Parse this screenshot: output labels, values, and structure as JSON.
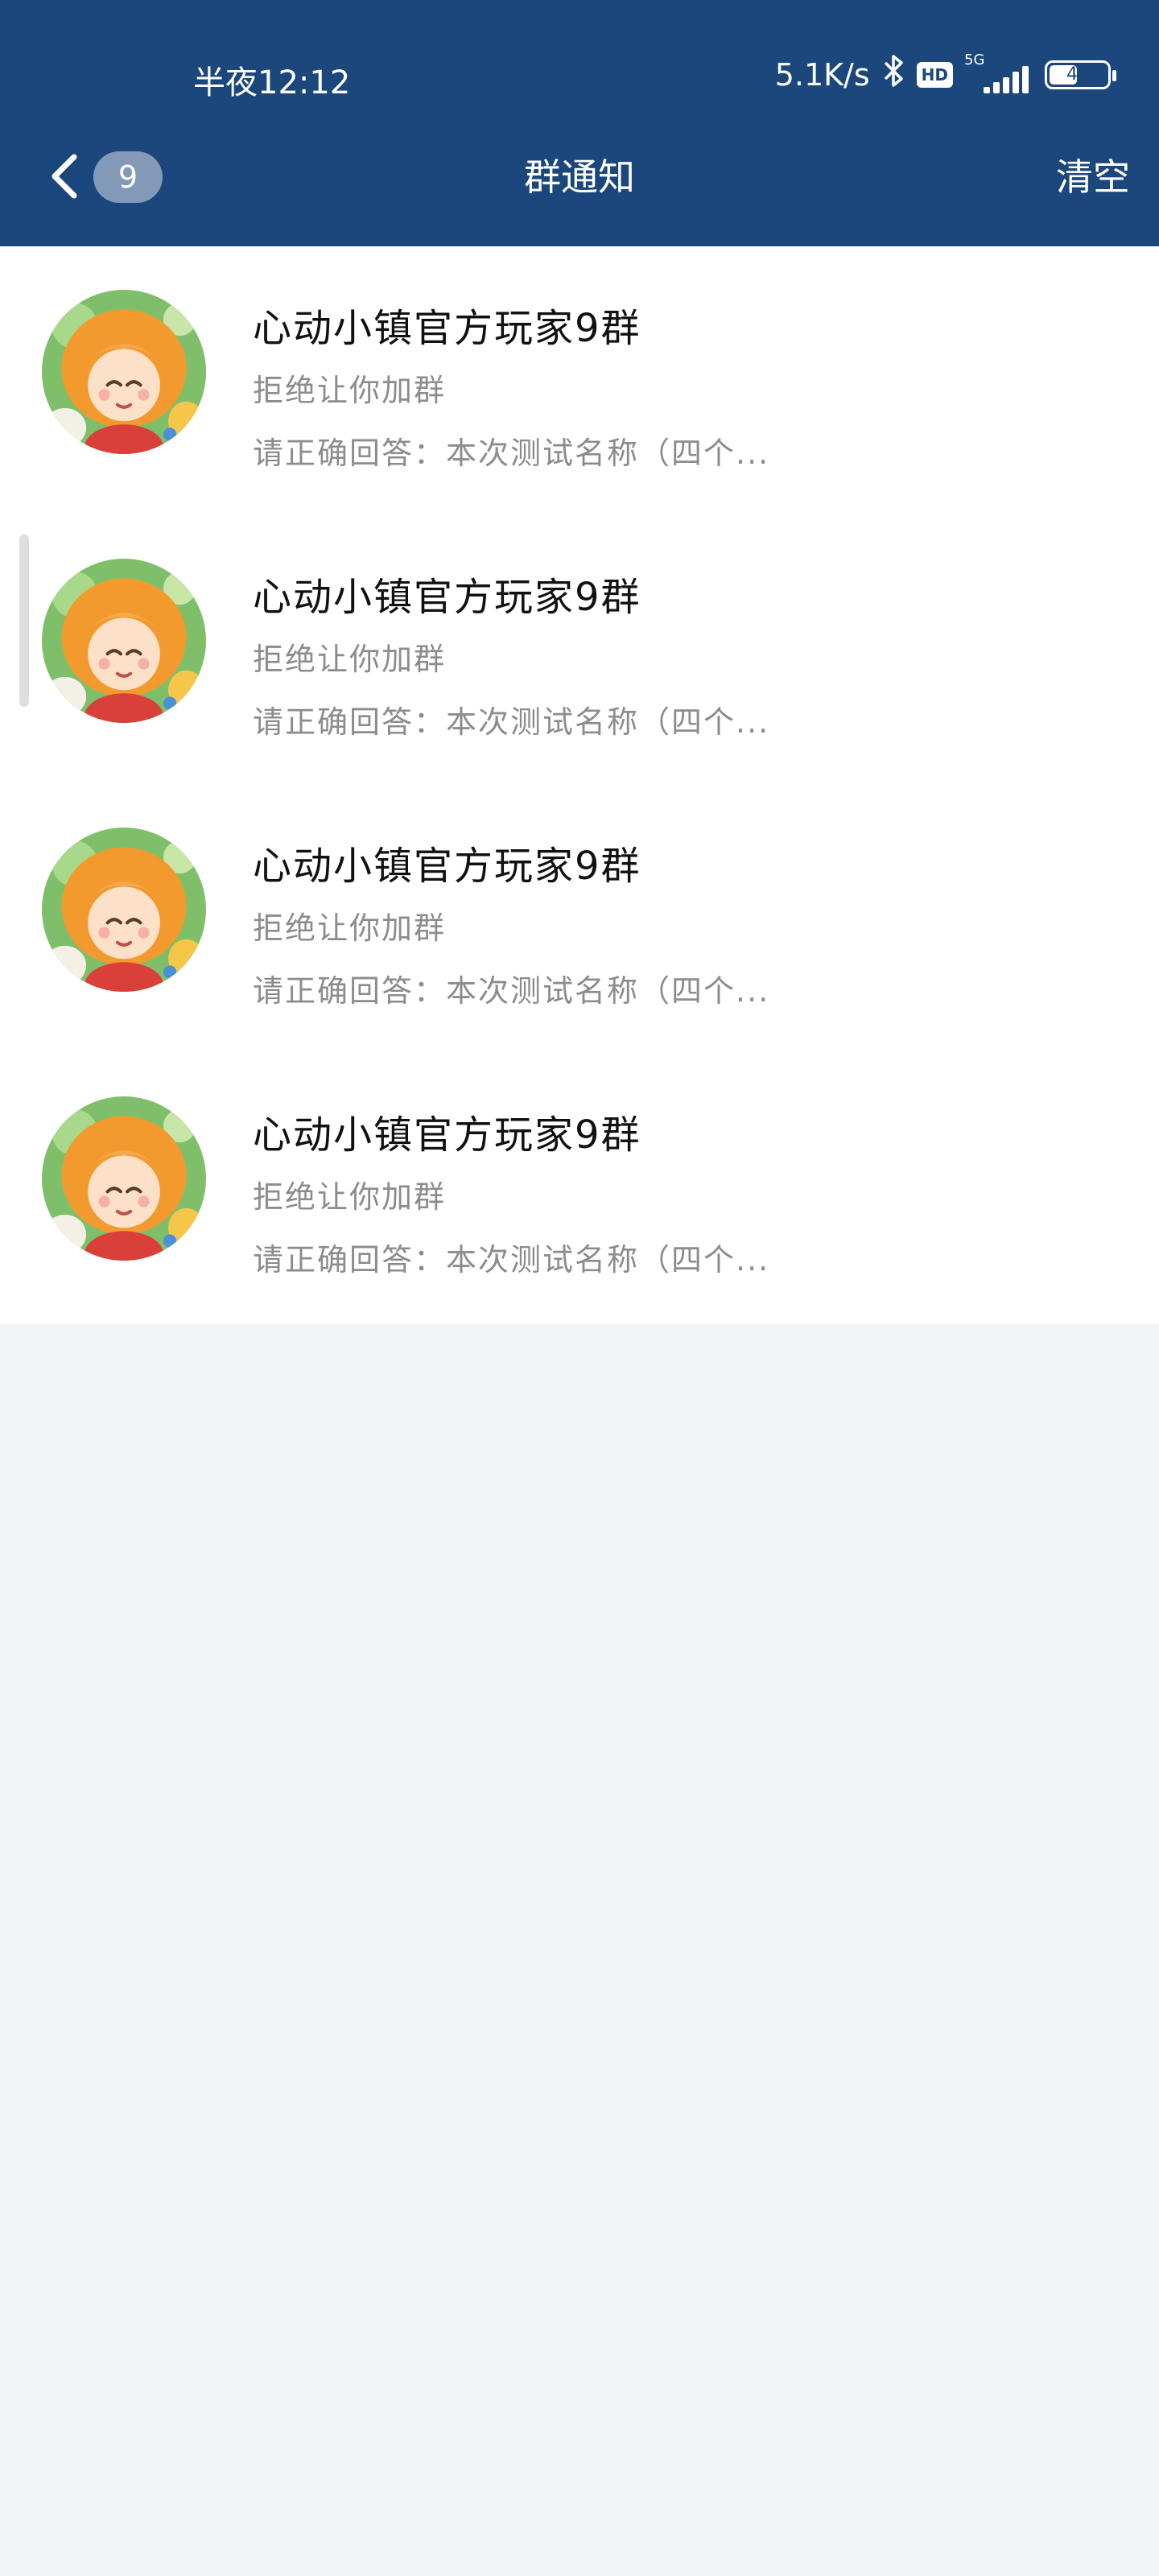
{
  "status_bar": {
    "time": "半夜12:12",
    "net_speed": "5.1K/s",
    "hd_label": "HD",
    "network_type": "5G",
    "battery_percent": "49",
    "battery_level": 0.49
  },
  "header": {
    "unread_count": "9",
    "title": "群通知",
    "clear_label": "清空",
    "background_color": "#1c477c"
  },
  "notifications": [
    {
      "group_name": "心动小镇官方玩家9群",
      "status": "拒绝让你加群",
      "answer": "请正确回答：本次测试名称（四个..."
    },
    {
      "group_name": "心动小镇官方玩家9群",
      "status": "拒绝让你加群",
      "answer": "请正确回答：本次测试名称（四个..."
    },
    {
      "group_name": "心动小镇官方玩家9群",
      "status": "拒绝让你加群",
      "answer": "请正确回答：本次测试名称（四个..."
    },
    {
      "group_name": "心动小镇官方玩家9群",
      "status": "拒绝让你加群",
      "answer": "请正确回答：本次测试名称（四个..."
    }
  ],
  "icons": {
    "back": "chevron-left-icon",
    "bluetooth": "bluetooth-icon",
    "signal": "signal-icon",
    "battery": "battery-icon"
  }
}
